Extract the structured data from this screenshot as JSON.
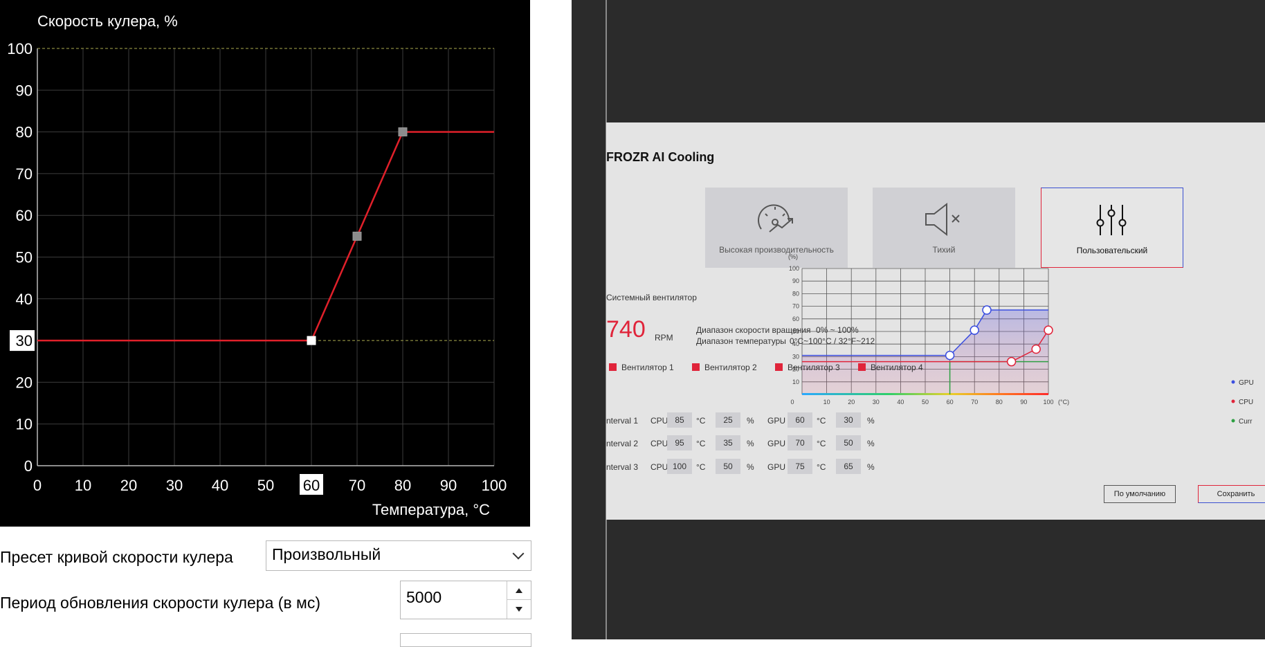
{
  "left_panel": {
    "chart_title": "Скорость кулера, %",
    "x_axis_label": "Температура, °C",
    "preset_label": "Пресет кривой скорости кулера",
    "preset_value": "Произвольный",
    "period_label": "Период обновления скорости кулера (в мс)",
    "period_value": "5000"
  },
  "right_panel": {
    "title": "FROZR AI Cooling",
    "modes": [
      {
        "label": "Высокая производительность",
        "icon": "speedometer-icon",
        "selected": false
      },
      {
        "label": "Тихий",
        "icon": "speaker-mute-icon",
        "selected": false
      },
      {
        "label": "Пользовательский",
        "icon": "sliders-icon",
        "selected": true
      }
    ],
    "system_fan_label": "Системный вентилятор",
    "rpm_value": "740",
    "rpm_unit": "RPM",
    "speed_range_label": "Диапазон скорости вращения",
    "speed_range_value": "0% ~ 100%",
    "temp_range_label": "Диапазон температуры",
    "temp_range_value": "0°C~100°C / 32°F~212",
    "fans": [
      "Вентилятор 1",
      "Вентилятор 2",
      "Вентилятор 3",
      "Вентилятор 4"
    ],
    "intervals": [
      {
        "label": "nterval 1",
        "cpu_label": "CPU",
        "cpu_temp": "85",
        "cpu_pct": "25",
        "gpu_label": "GPU",
        "gpu_temp": "60",
        "gpu_pct": "30"
      },
      {
        "label": "nterval 2",
        "cpu_label": "CPU",
        "cpu_temp": "95",
        "cpu_pct": "35",
        "gpu_label": "GPU",
        "gpu_temp": "70",
        "gpu_pct": "50"
      },
      {
        "label": "nterval 3",
        "cpu_label": "CPU",
        "cpu_temp": "100",
        "cpu_pct": "50",
        "gpu_label": "GPU",
        "gpu_temp": "75",
        "gpu_pct": "65"
      }
    ],
    "unit_c": "°C",
    "unit_pct": "%",
    "legend": [
      "GPU",
      "CPU",
      "Curr"
    ],
    "y_unit": "(%)",
    "x_unit": "(°C)",
    "default_button": "По умолчанию",
    "save_button": "Сохранить"
  },
  "colors": {
    "curve_red": "#e0202a",
    "grid_olive": "#8a8a40",
    "accent_red": "#e0243a",
    "accent_blue": "#3a4fd0",
    "gpu_blue": "#3b4fe0",
    "cpu_red": "#e0243a",
    "current_green": "#2ea043"
  },
  "chart_data": [
    {
      "type": "line",
      "title": "Скорость кулера, %",
      "xlabel": "Температура, °C",
      "ylabel": "",
      "xlim": [
        0,
        100
      ],
      "ylim": [
        0,
        100
      ],
      "x_ticks": [
        0,
        10,
        20,
        30,
        40,
        50,
        60,
        70,
        80,
        90,
        100
      ],
      "y_ticks": [
        0,
        10,
        20,
        30,
        40,
        50,
        60,
        70,
        80,
        90,
        100
      ],
      "highlight_x": 60,
      "highlight_y": 30,
      "series": [
        {
          "values": [
            [
              0,
              30
            ],
            [
              60,
              30
            ],
            [
              70,
              55
            ],
            [
              80,
              80
            ],
            [
              100,
              80
            ]
          ]
        }
      ],
      "points": [
        [
          60,
          30
        ],
        [
          70,
          55
        ],
        [
          80,
          80
        ]
      ],
      "grid": true,
      "legend": "none"
    },
    {
      "type": "line",
      "title": "",
      "xlabel": "(°C)",
      "ylabel": "(%)",
      "xlim": [
        0,
        100
      ],
      "ylim": [
        0,
        100
      ],
      "x_ticks": [
        0,
        10,
        20,
        30,
        40,
        50,
        60,
        70,
        80,
        90,
        100
      ],
      "y_ticks": [
        10,
        20,
        30,
        40,
        50,
        60,
        70,
        80,
        90,
        100
      ],
      "series": [
        {
          "name": "GPU",
          "values": [
            [
              0,
              31
            ],
            [
              60,
              31
            ],
            [
              70,
              51
            ],
            [
              75,
              67
            ],
            [
              100,
              67
            ]
          ]
        },
        {
          "name": "CPU",
          "values": [
            [
              0,
              26
            ],
            [
              85,
              26
            ],
            [
              95,
              36
            ],
            [
              100,
              51
            ]
          ]
        },
        {
          "name": "Curr",
          "values": [
            [
              60,
              26
            ],
            [
              100,
              26
            ]
          ]
        }
      ],
      "grid": true,
      "legend": "right"
    }
  ]
}
